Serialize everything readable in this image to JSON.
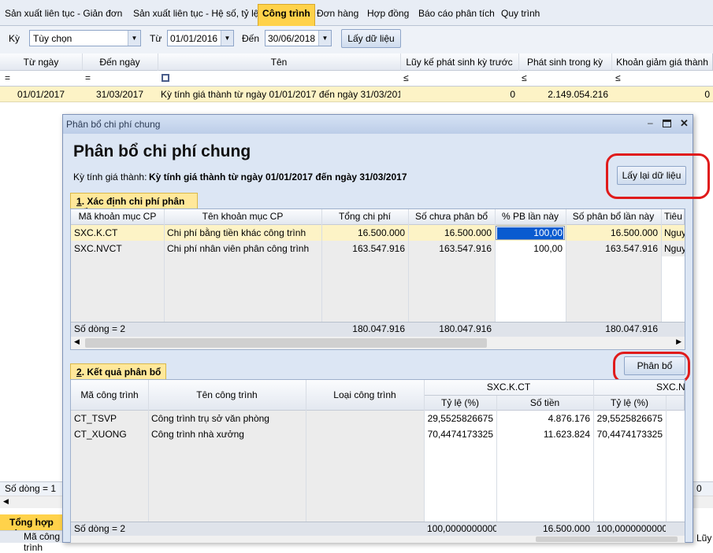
{
  "tabs": [
    "Sản xuất liên tục - Giản đơn",
    "Sản xuất liên tục - Hệ số, tỷ lệ",
    "Công trình",
    "Đơn hàng",
    "Hợp đồng",
    "Báo cáo phân tích",
    "Quy trình"
  ],
  "active_tab": "Công trình",
  "filter": {
    "ky_label": "Kỳ",
    "ky_value": "Tùy chọn",
    "tu_label": "Từ",
    "tu_value": "01/01/2016",
    "den_label": "Đến",
    "den_value": "30/06/2018",
    "get_button": "Lấy dữ liệu"
  },
  "main_grid": {
    "columns": [
      "Từ ngày",
      "Đến ngày",
      "Tên",
      "Lũy kế phát sinh kỳ trước",
      "Phát sinh trong kỳ",
      "Khoản giảm giá thành"
    ],
    "filter_ops": [
      "=",
      "=",
      "≤",
      "≤",
      "≤"
    ],
    "row": {
      "tu": "01/01/2017",
      "den": "31/03/2017",
      "ten": "Kỳ tính giá thành từ ngày 01/01/2017 đến ngày 31/03/2017",
      "luyke": "0",
      "phatsinh": "2.149.054.216",
      "giam": "0"
    },
    "footer": "Số dòng = 1",
    "bottom_tab": "Tổng hợp ch",
    "bottom_col": "Mã công trình",
    "bottom_right_zero": "0",
    "bottom_right_luy": "Lũy"
  },
  "dialog": {
    "window_title": "Phân bổ chi phí chung",
    "heading": "Phân bổ chi phí chung",
    "period_label": "Kỳ tính giá thành:",
    "period_value": "Kỳ tính giá thành từ ngày 01/01/2017 đến ngày 31/03/2017",
    "reload_button": "Lấy lại dữ liệu",
    "section1": {
      "tab_num": "1",
      "tab_text": ". Xác định chi phí phân bổ",
      "columns": [
        "Mã khoản mục CP",
        "Tên khoản mục CP",
        "Tổng chi phí",
        "Số chưa phân bổ",
        "% PB lần này",
        "Số phân bổ lần này",
        "Tiêu"
      ],
      "rows": [
        {
          "ma": "SXC.K.CT",
          "ten": "Chi phí bằng tiền khác công trình",
          "tong": "16.500.000",
          "chua": "16.500.000",
          "pct": "100,00",
          "so": "16.500.000",
          "tieu": "Nguy"
        },
        {
          "ma": "SXC.NVCT",
          "ten": "Chi phí nhân viên phân công trình",
          "tong": "163.547.916",
          "chua": "163.547.916",
          "pct": "100,00",
          "so": "163.547.916",
          "tieu": "Nguy"
        }
      ],
      "footer": {
        "label": "Số dòng = 2",
        "tong": "180.047.916",
        "chua": "180.047.916",
        "so": "180.047.916"
      }
    },
    "section2": {
      "tab_num": "2",
      "tab_text": ". Kết quả phân bổ",
      "allocate_button": "Phân bổ",
      "columns": {
        "ma": "Mã công trình",
        "ten": "Tên công trình",
        "loai": "Loại công trình",
        "group1": "SXC.K.CT",
        "group2": "SXC.NV",
        "tyle": "Tỷ lệ (%)",
        "sotien": "Số tiền"
      },
      "rows": [
        {
          "ma": "CT_TSVP",
          "ten": "Công trình trụ sở văn phòng",
          "tyle1": "29,5525826675",
          "sotien1": "4.876.176",
          "tyle2": "29,5525826675"
        },
        {
          "ma": "CT_XUONG",
          "ten": "Công trình nhà xưởng",
          "tyle1": "70,4474173325",
          "sotien1": "11.623.824",
          "tyle2": "70,4474173325"
        }
      ],
      "footer": {
        "label": "Số dòng = 2",
        "tyle1": "100,0000000000",
        "sotien1": "16.500.000",
        "tyle2": "100,0000000000"
      }
    }
  }
}
